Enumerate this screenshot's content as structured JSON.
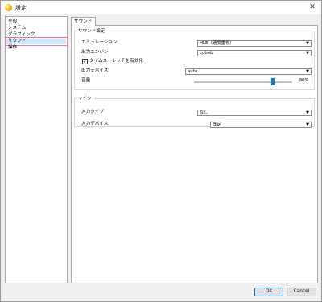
{
  "window": {
    "title": "設定"
  },
  "sidebar": {
    "items": [
      {
        "label": "全般"
      },
      {
        "label": "システム"
      },
      {
        "label": "グラフィック"
      },
      {
        "label": "サウンド"
      },
      {
        "label": "操作"
      }
    ],
    "selected": "サウンド"
  },
  "tabs": [
    {
      "label": "サウンド"
    }
  ],
  "sound_settings": {
    "legend": "サウンド設定",
    "emulation": {
      "label": "エミュレーション",
      "value": "HLE（速度重視）"
    },
    "output_engine": {
      "label": "出力エンジン",
      "value": "cubeb"
    },
    "time_stretch": {
      "label": "タイムストレッチを有効化",
      "checked": true
    },
    "output_device": {
      "label": "出力デバイス",
      "value": "auto"
    },
    "volume": {
      "label": "音量",
      "value_text": "80%",
      "level_percent": 80
    }
  },
  "mic": {
    "legend": "マイク",
    "input_type": {
      "label": "入力タイプ",
      "value": "なし"
    },
    "input_device": {
      "label": "入力デバイス",
      "value": "既定"
    }
  },
  "buttons": {
    "ok": "OK",
    "cancel": "Cancel"
  },
  "colors": {
    "selection": "#cce8ff",
    "highlight_outline": "#ff6fa3",
    "accent": "#0078d7"
  }
}
